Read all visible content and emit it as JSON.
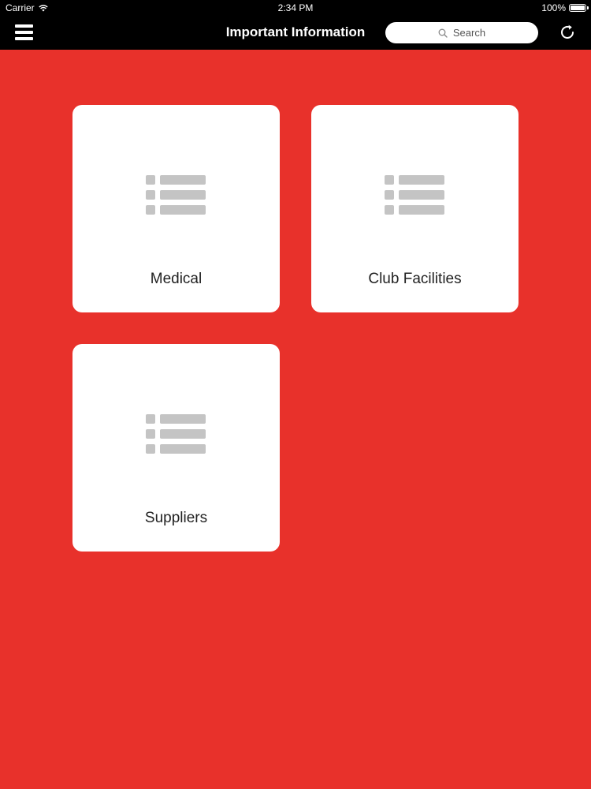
{
  "status_bar": {
    "carrier": "Carrier",
    "time": "2:34 PM",
    "battery_text": "100%",
    "battery_level": 1.0
  },
  "nav_bar": {
    "title": "Important Information",
    "search_placeholder": "Search",
    "menu_icon": "hamburger-menu-icon",
    "refresh_icon": "refresh-icon"
  },
  "tiles": [
    {
      "label": "Medical",
      "icon": "list-icon"
    },
    {
      "label": "Club Facilities",
      "icon": "list-icon"
    },
    {
      "label": "Suppliers",
      "icon": "list-icon"
    }
  ],
  "colors": {
    "background": "#e8312b",
    "nav_bar": "#000000",
    "tile": "#ffffff",
    "icon_gray": "#c4c4c4"
  }
}
